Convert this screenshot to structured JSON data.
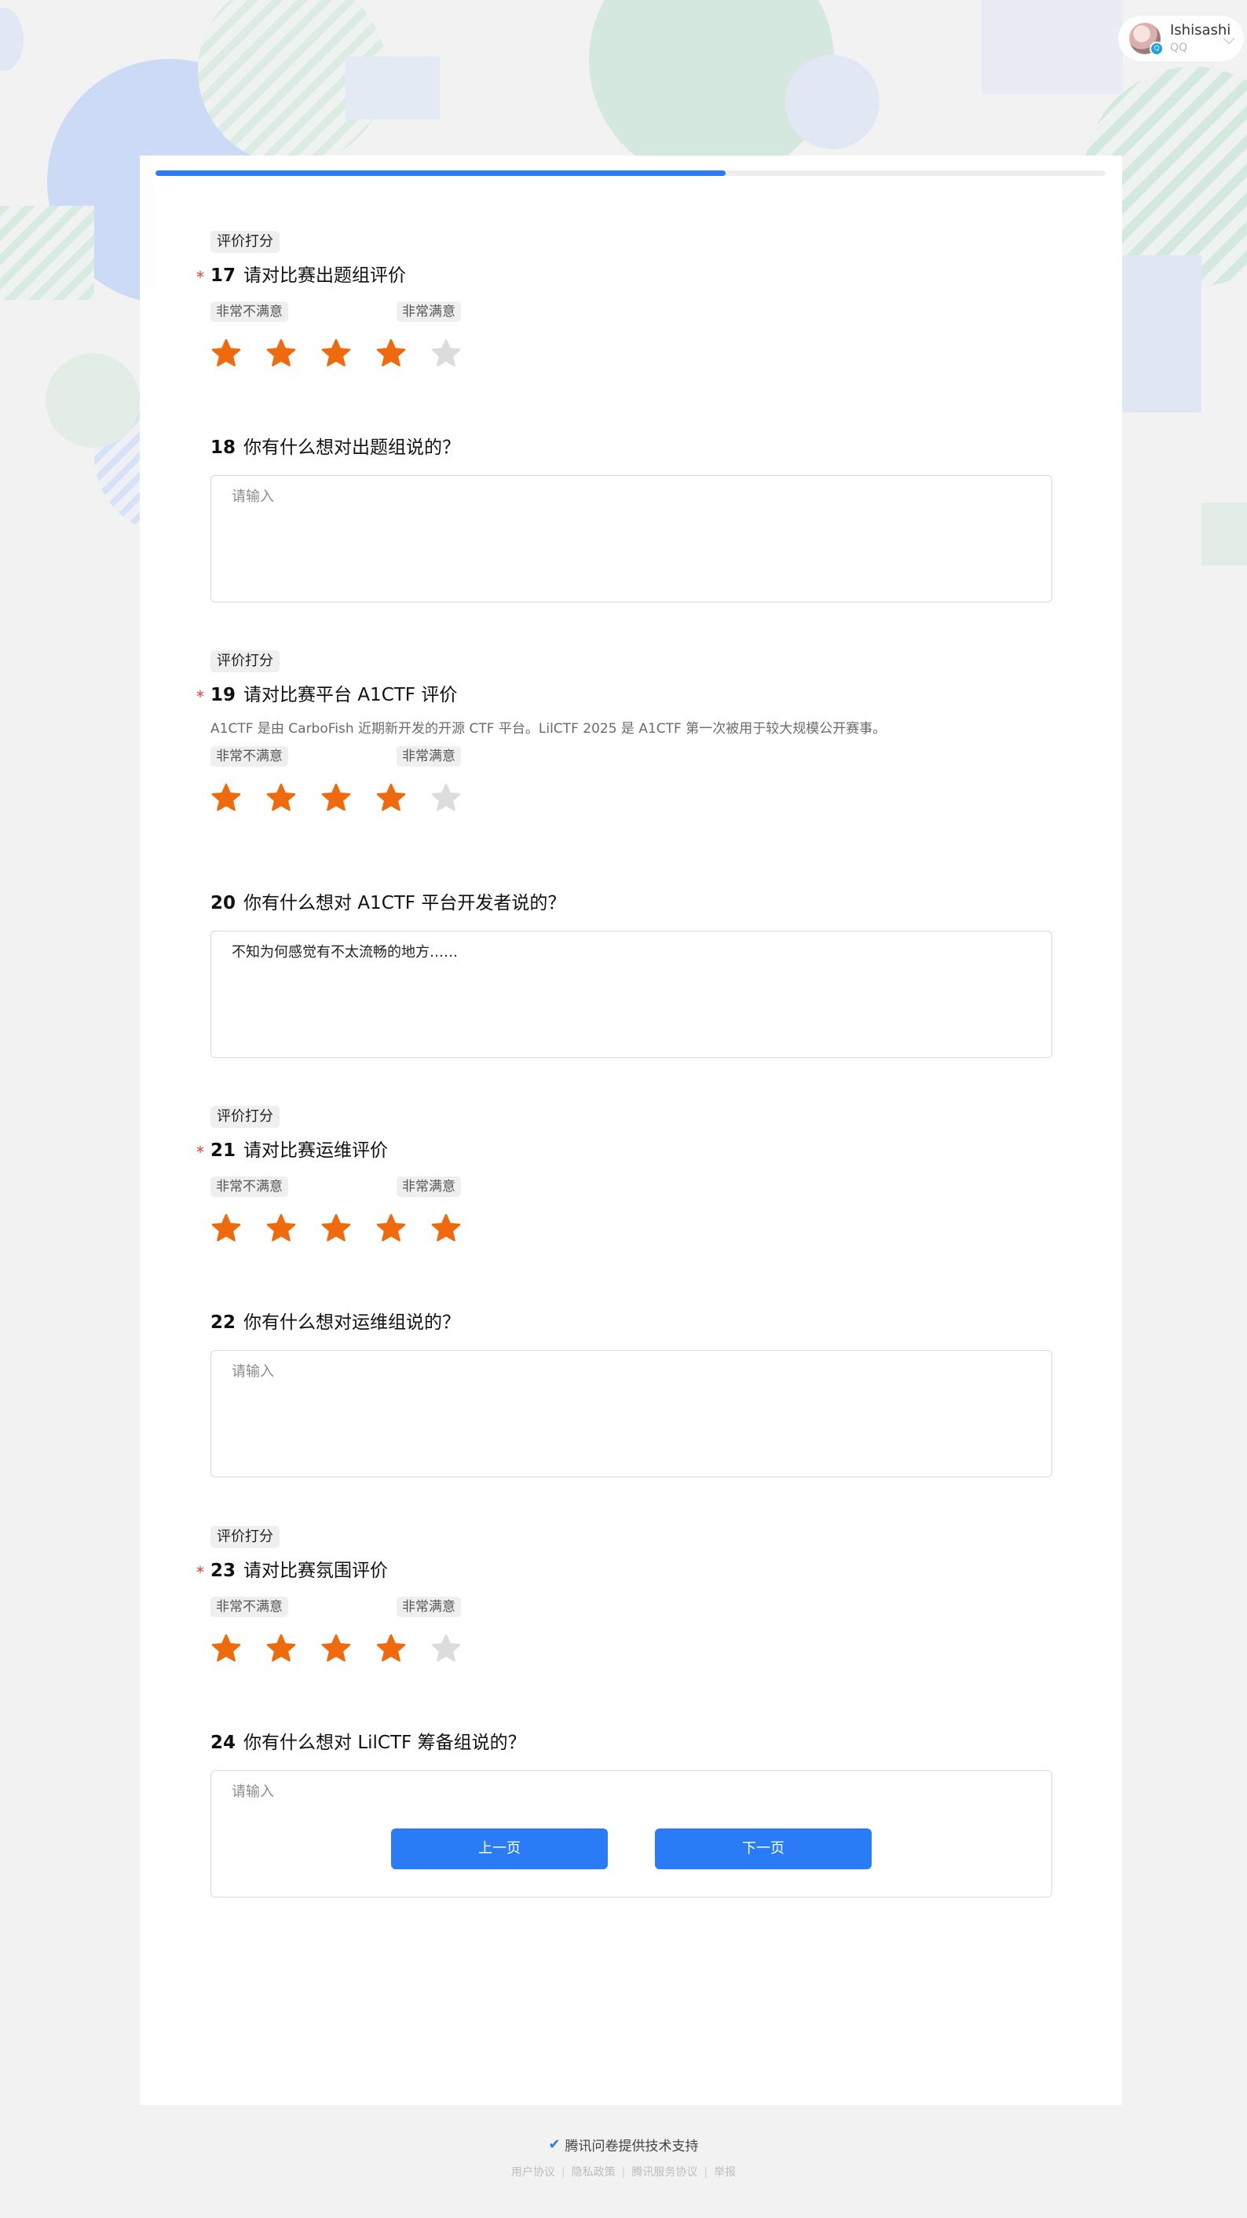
{
  "account": {
    "name": "Ishisashi",
    "platform": "QQ"
  },
  "progress": {
    "percent": 60
  },
  "colors": {
    "accent": "#2a7cf6",
    "star_active": "#ee6a0c",
    "star_inactive": "#dcdcdc",
    "required": "#e53935"
  },
  "questions": [
    {
      "tag": "评价打分",
      "required": true,
      "number": "17",
      "title": "请对比赛出题组评价",
      "low_label": "非常不满意",
      "high_label": "非常满意",
      "rating": 4,
      "max": 5
    },
    {
      "number": "18",
      "title": "你有什么想对出题组说的？",
      "placeholder": "请输入",
      "value": ""
    },
    {
      "tag": "评价打分",
      "required": true,
      "number": "19",
      "title": "请对比赛平台 A1CTF 评价",
      "description": "A1CTF 是由 CarboFish 近期新开发的开源 CTF 平台。LilCTF 2025 是 A1CTF 第一次被用于较大规模公开赛事。",
      "low_label": "非常不满意",
      "high_label": "非常满意",
      "rating": 4,
      "max": 5
    },
    {
      "number": "20",
      "title": "你有什么想对 A1CTF 平台开发者说的？",
      "placeholder": "请输入",
      "value": "不知为何感觉有不太流畅的地方……"
    },
    {
      "tag": "评价打分",
      "required": true,
      "number": "21",
      "title": "请对比赛运维评价",
      "low_label": "非常不满意",
      "high_label": "非常满意",
      "rating": 5,
      "max": 5
    },
    {
      "number": "22",
      "title": "你有什么想对运维组说的？",
      "placeholder": "请输入",
      "value": ""
    },
    {
      "tag": "评价打分",
      "required": true,
      "number": "23",
      "title": "请对比赛氛围评价",
      "low_label": "非常不满意",
      "high_label": "非常满意",
      "rating": 4,
      "max": 5
    },
    {
      "number": "24",
      "title": "你有什么想对 LilCTF 筹备组说的？",
      "placeholder": "请输入",
      "value": ""
    }
  ],
  "nav": {
    "prev_label": "上一页",
    "next_label": "下一页"
  },
  "footer": {
    "powered_by": "腾讯问卷提供技术支持",
    "links": [
      "用户协议",
      "隐私政策",
      "腾讯服务协议",
      "举报"
    ]
  }
}
